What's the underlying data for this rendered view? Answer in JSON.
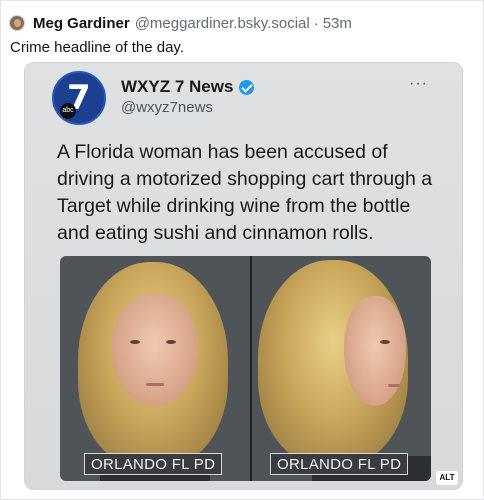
{
  "post": {
    "author_name": "Meg Gardiner",
    "author_handle": "@meggardiner.bsky.social",
    "separator": "·",
    "time": "53m",
    "text": "Crime headline of the day."
  },
  "embedded": {
    "account_name": "WXYZ 7 News",
    "account_handle": "@wxyz7news",
    "logo_number": "7",
    "logo_sub": "abc",
    "more_icon": "···",
    "headline": "A Florida woman has been accused of driving a motorized shopping cart through a Target while drinking wine from the bottle and eating sushi and cinnamon rolls.",
    "photo_left_label": "ORLANDO FL PD",
    "photo_right_label": "ORLANDO FL PD"
  },
  "alt_badge": "ALT",
  "colors": {
    "verified": "#1d9bf0",
    "logo_blue": "#1d3f8f"
  }
}
